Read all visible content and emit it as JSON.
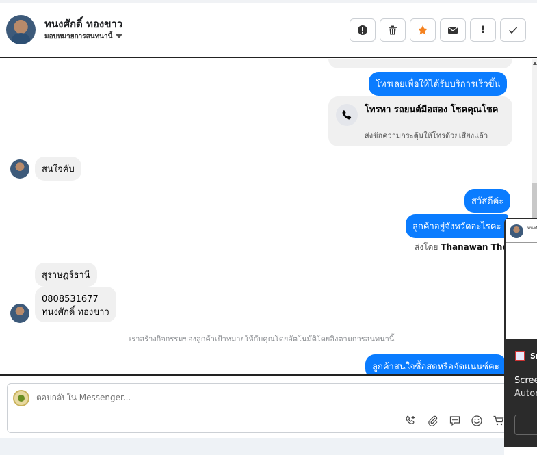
{
  "header": {
    "contact_name": "ทนงศักดิ์ ทองขาว",
    "assign_label": "มอบหมายการสนทนานี้",
    "actions": [
      {
        "name": "report-button",
        "icon": "alert-circle-icon"
      },
      {
        "name": "delete-button",
        "icon": "trash-icon"
      },
      {
        "name": "star-button",
        "icon": "star-icon",
        "color": "#f5821f"
      },
      {
        "name": "email-button",
        "icon": "mail-icon"
      },
      {
        "name": "important-button",
        "label": "!"
      },
      {
        "name": "done-button",
        "icon": "check-icon"
      }
    ]
  },
  "messages": {
    "out_call_prompt": "โทรเลยเพื่อให้ได้รับบริการเร็วขึ้น",
    "call_card_title": "โทรหา รถยนต์มือสอง โชคคุณโชค",
    "call_card_subtitle": "ส่งข้อความกระตุ้นให้โทรด้วยเสียงแล้ว",
    "in_interested": "สนใจคับ",
    "out_greeting": "สวัสดีค่ะ",
    "out_province_q": "ลูกค้าอยู่จังหวัดอะไรคะ",
    "sent_by_prefix": "ส่งโดย",
    "sent_by_name": "Thanawan Thon",
    "in_province": "สุราษฎร์ธานี",
    "in_phone": "0808531677",
    "in_fullname": "ทนงศักดิ์   ทองขาว",
    "system_note": "เราสร้างกิจกรรมของลูกค้าเป้าหมายให้กับคุณโดยอัตโนมัติโดยอิงตามการสนทนานี้",
    "out_cash_q": "ลูกค้าสนใจซื้อสดหรือจัดแนนซ์คะ"
  },
  "composer": {
    "placeholder": "ตอบกลับใน Messenger..."
  },
  "overlay": {
    "mini_name": "ทนงศั",
    "app_label": "Sn",
    "line1": "Scree",
    "line2": "Autor"
  },
  "colors": {
    "accent": "#0a7cff",
    "incoming_bubble": "#f0f0f0",
    "star": "#f5821f"
  }
}
